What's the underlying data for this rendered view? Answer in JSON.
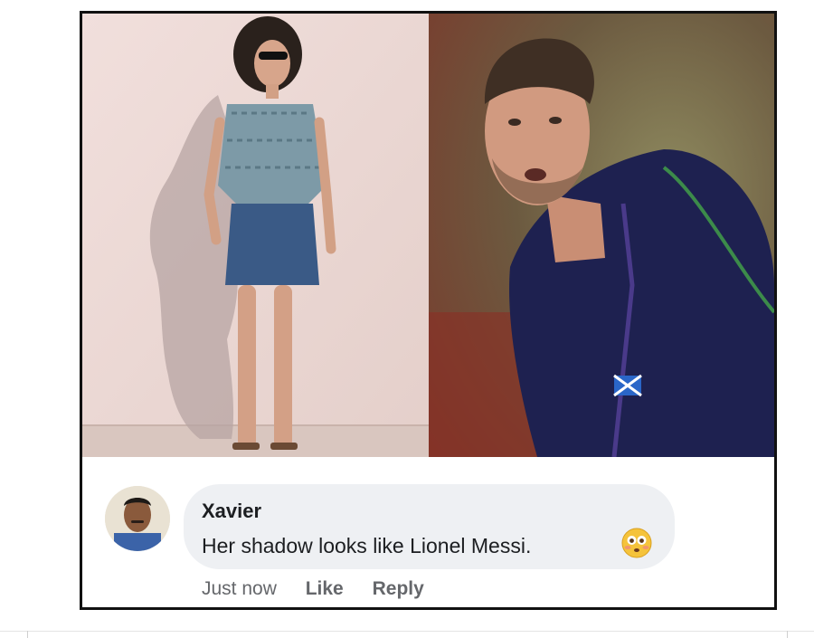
{
  "post": {
    "images": [
      {
        "name": "woman-against-wall-photo",
        "bg": "#ecd9d6"
      },
      {
        "name": "rugby-player-photo",
        "bg": "#6c5a40"
      }
    ]
  },
  "comment": {
    "author": "Xavier",
    "text": "Her shadow looks like Lionel Messi.",
    "emoji": "flushed-face-emoji",
    "timestamp": "Just now",
    "like_label": "Like",
    "reply_label": "Reply"
  },
  "colors": {
    "bubble": "#eef0f3",
    "action_text": "#65676b",
    "jersey": "#1e2150"
  }
}
